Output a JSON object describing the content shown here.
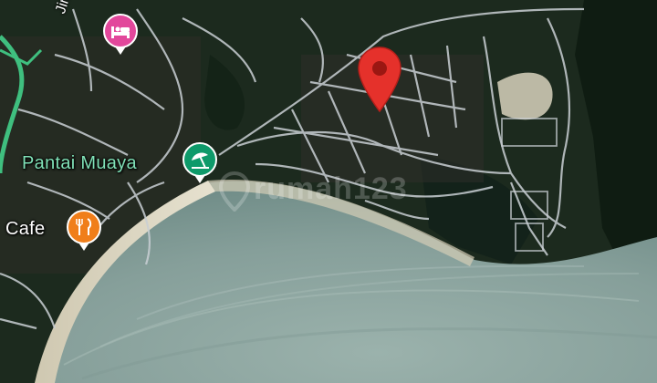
{
  "map": {
    "type": "satellite",
    "colors": {
      "sea": "#8fa7a2",
      "land": "#1c2a1e",
      "roads": "#c9cfd4",
      "beach": "#d9d3bf",
      "pin": "#e5312b",
      "hotel_poi": "#e2479b",
      "beach_poi": "#0e9a6a",
      "cafe_poi": "#f07e1a",
      "main_road": "#3fbf7f"
    }
  },
  "road_label": "Jim",
  "pois": [
    {
      "id": "hotel",
      "label": "",
      "icon": "bed-icon"
    },
    {
      "id": "beach",
      "label": "Pantai Muaya",
      "icon": "beach-umbrella-icon"
    },
    {
      "id": "cafe",
      "label": "Cafe",
      "icon": "fork-knife-icon"
    }
  ],
  "pin": {
    "icon": "location-pin-icon"
  },
  "watermark": "rumah123"
}
